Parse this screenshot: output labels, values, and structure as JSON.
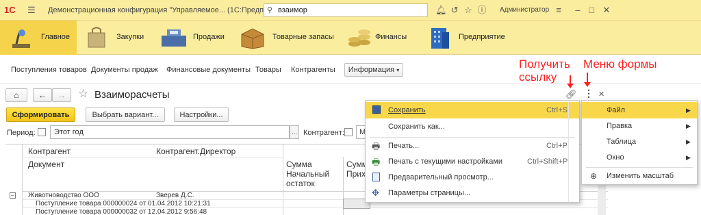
{
  "titlebar": {
    "logo": "1С",
    "title": "Демонстрационная конфигурация \"Управляемое... (1С:Предприятие)",
    "search_value": "взаимор",
    "user": "Администратор"
  },
  "sections": [
    {
      "label": "Главное",
      "icon": "desk-lamp-icon"
    },
    {
      "label": "Закупки",
      "icon": "shopping-bag-icon"
    },
    {
      "label": "Продажи",
      "icon": "cash-register-icon"
    },
    {
      "label": "Товарные запасы",
      "icon": "box-icon"
    },
    {
      "label": "Финансы",
      "icon": "coins-icon"
    },
    {
      "label": "Предприятие",
      "icon": "building-icon"
    }
  ],
  "nav": {
    "items": [
      "Поступления товаров",
      "Документы продаж",
      "Финансовые документы",
      "Товары",
      "Контрагенты"
    ],
    "info_button": "Информация"
  },
  "form": {
    "title": "Взаиморасчеты",
    "generate_button": "Сформировать",
    "choose_variant_button": "Выбрать вариант...",
    "settings_button": "Настройки...",
    "period_label": "Период:",
    "period_value": "Этот год",
    "counterparty_label": "Контрагент:",
    "counterparty_value": "М"
  },
  "report": {
    "header_contragent": "Контрагент",
    "header_director": "Контрагент.Директор",
    "header_document": "Документ",
    "col_sum_start": "Сумма\nНачальный\nостаток",
    "col_sum_income": "Сумма\nПриход",
    "rows": [
      {
        "a": "Животноводство ООО",
        "b": "Зверев Д.С."
      },
      {
        "a": "Поступление товара 000000024 от 01.04.2012 10:21:31",
        "b": ""
      },
      {
        "a": "Поступление товара 000000032 от 12.04.2012 9:56:48",
        "b": ""
      }
    ]
  },
  "context_menu": {
    "items": [
      {
        "label": "Сохранить",
        "shortcut": "Ctrl+S",
        "icon": "floppy-icon"
      },
      {
        "label": "Сохранить как...",
        "shortcut": "",
        "icon": ""
      },
      {
        "label": "Печать...",
        "shortcut": "Ctrl+P",
        "icon": "printer-icon"
      },
      {
        "label": "Печать с текущими настройками",
        "shortcut": "Ctrl+Shift+P",
        "icon": "printer-settings-icon"
      },
      {
        "label": "Предварительный просмотр...",
        "shortcut": "",
        "icon": "print-preview-icon"
      },
      {
        "label": "Параметры страницы...",
        "shortcut": "",
        "icon": "page-setup-icon"
      }
    ]
  },
  "form_menu": {
    "items": [
      {
        "label": "Файл",
        "submenu": true
      },
      {
        "label": "Правка",
        "submenu": true
      },
      {
        "label": "Таблица",
        "submenu": true
      },
      {
        "label": "Окно",
        "submenu": true
      },
      {
        "label": "Изменить масштаб",
        "submenu": false
      }
    ]
  },
  "annotations": {
    "get_link": "Получить\nссылку",
    "form_menu": "Меню формы"
  },
  "colors": {
    "accent": "#f5d34a",
    "titlebar": "#fbed9e",
    "annotation": "#ff2020"
  }
}
